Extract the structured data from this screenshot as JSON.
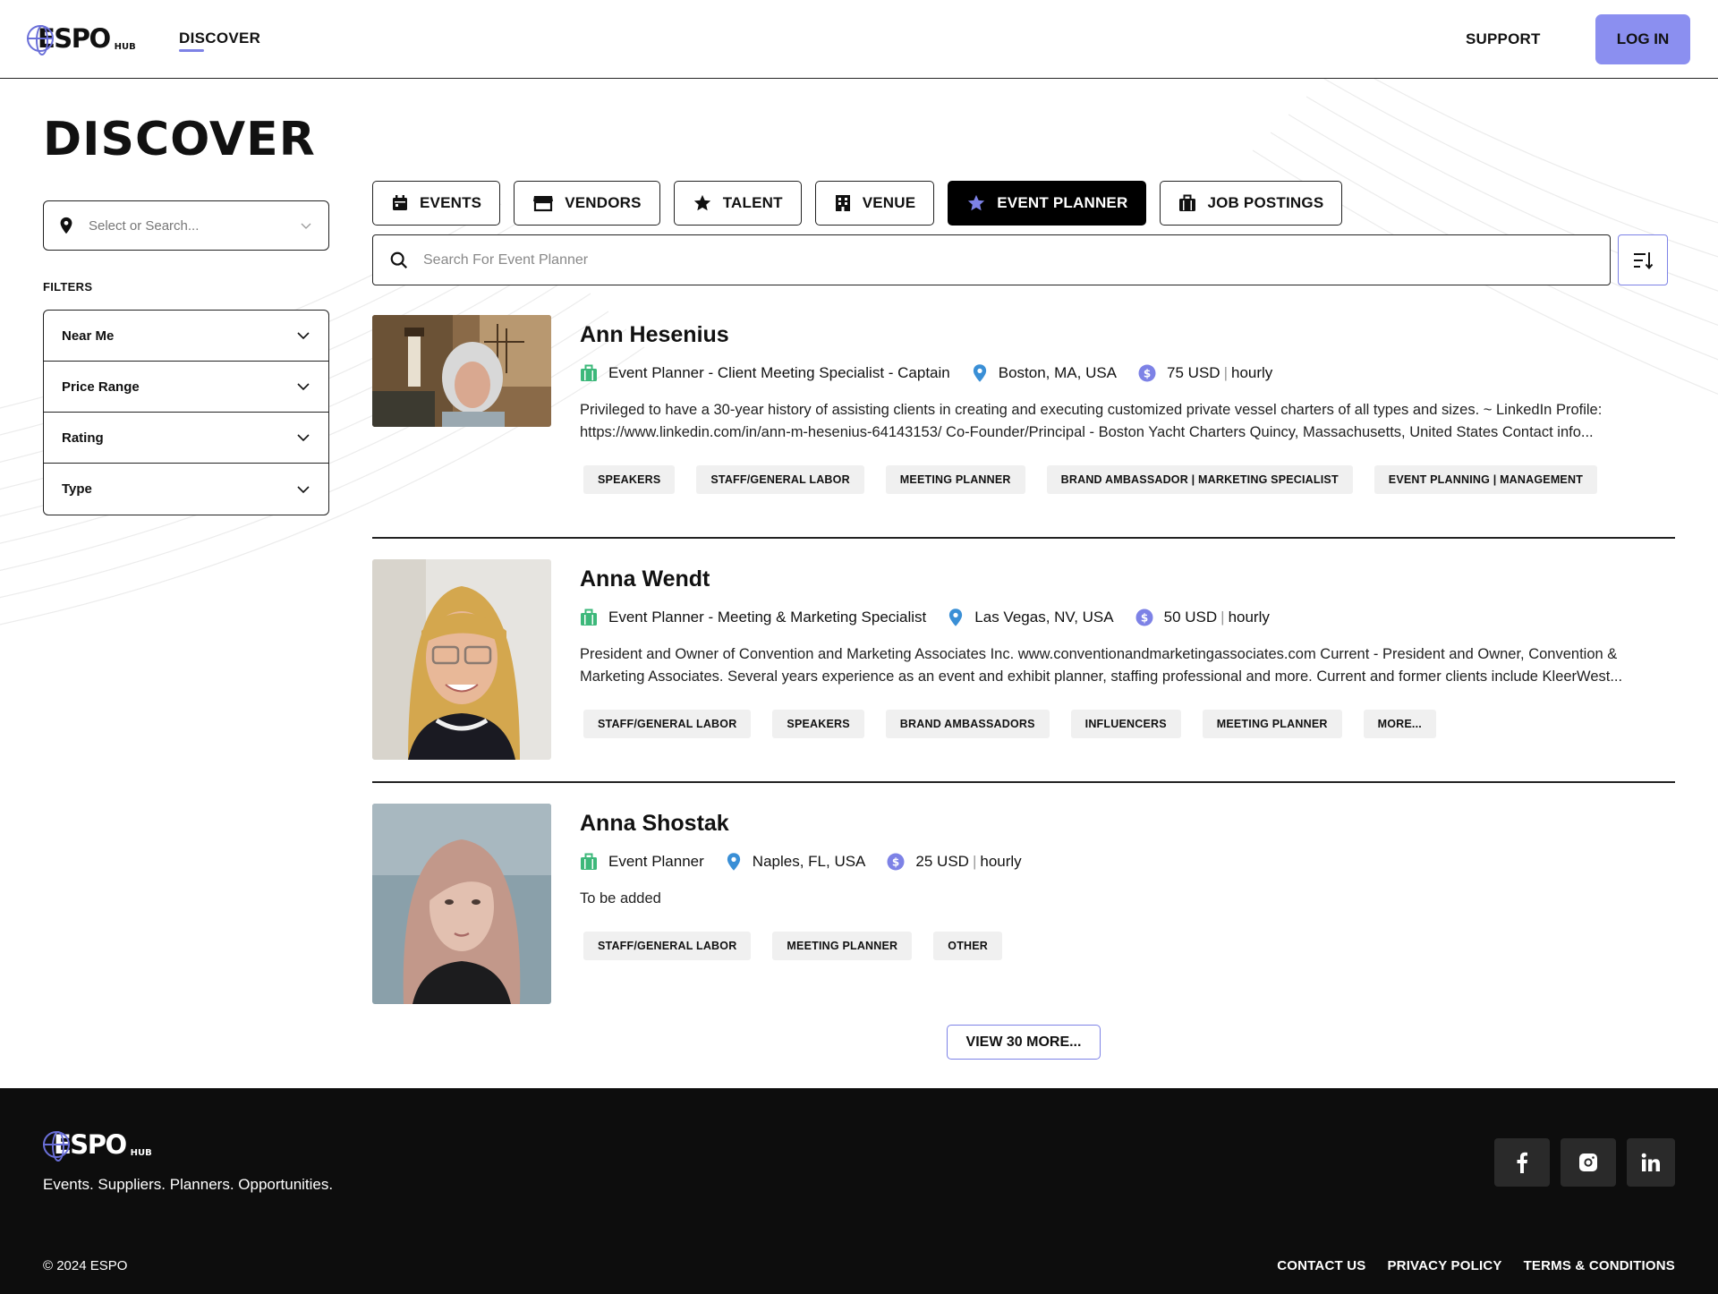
{
  "header": {
    "logo_text": "ESPO",
    "logo_sub": "HUB",
    "nav_discover": "DISCOVER",
    "nav_support": "SUPPORT",
    "login_label": "LOG IN"
  },
  "page_title": "DISCOVER",
  "location": {
    "placeholder": "Select or Search..."
  },
  "filters": {
    "label": "FILTERS",
    "items": [
      "Near Me",
      "Price Range",
      "Rating",
      "Type"
    ]
  },
  "tabs": [
    {
      "label": "EVENTS",
      "icon": "calendar-icon",
      "active": false
    },
    {
      "label": "VENDORS",
      "icon": "store-icon",
      "active": false
    },
    {
      "label": "TALENT",
      "icon": "star-icon",
      "active": false
    },
    {
      "label": "VENUE",
      "icon": "building-icon",
      "active": false
    },
    {
      "label": "EVENT PLANNER",
      "icon": "star-icon",
      "active": true
    },
    {
      "label": "JOB POSTINGS",
      "icon": "briefcase-icon",
      "active": false
    }
  ],
  "search": {
    "placeholder": "Search For Event Planner"
  },
  "listings": [
    {
      "name": "Ann Hesenius",
      "role": "Event Planner - Client Meeting Specialist - Captain",
      "location": "Boston, MA, USA",
      "rate": "75 USD",
      "rate_unit": "hourly",
      "description": "Privileged to have a 30-year history of assisting clients in creating and executing customized private vessel charters of all types and sizes. ~ LinkedIn Profile: https://www.linkedin.com/in/ann-m-hesenius-64143153/ Co-Founder/Principal - Boston Yacht Charters Quincy, Massachusetts, United States Contact info...",
      "tags": [
        "SPEAKERS",
        "STAFF/GENERAL LABOR",
        "MEETING PLANNER",
        "BRAND AMBASSADOR | MARKETING SPECIALIST",
        "EVENT PLANNING | MANAGEMENT"
      ]
    },
    {
      "name": "Anna Wendt",
      "role": "Event Planner - Meeting & Marketing Specialist",
      "location": "Las Vegas, NV, USA",
      "rate": "50 USD",
      "rate_unit": "hourly",
      "description": "President and Owner of Convention and Marketing Associates Inc. www.conventionandmarketingassociates.com Current - President and Owner, Convention & Marketing Associates. Several years experience as an event and exhibit planner, staffing professional and more. Current and former clients include KleerWest...",
      "tags": [
        "STAFF/GENERAL LABOR",
        "SPEAKERS",
        "BRAND AMBASSADORS",
        "INFLUENCERS",
        "MEETING PLANNER",
        "MORE..."
      ]
    },
    {
      "name": "Anna Shostak",
      "role": "Event Planner",
      "location": "Naples, FL, USA",
      "rate": "25 USD",
      "rate_unit": "hourly",
      "description": "To be added",
      "tags": [
        "STAFF/GENERAL LABOR",
        "MEETING PLANNER",
        "OTHER"
      ]
    }
  ],
  "view_more_label": "VIEW 30 MORE...",
  "footer": {
    "tagline": "Events. Suppliers. Planners. Opportunities.",
    "copyright": "© 2024 ESPO",
    "links": [
      "CONTACT US",
      "PRIVACY POLICY",
      "TERMS & CONDITIONS"
    ],
    "socials": [
      "facebook-icon",
      "instagram-icon",
      "linkedin-icon"
    ]
  },
  "colors": {
    "accent": "#8b8ff0",
    "role_icon": "#3cb87a",
    "location_icon": "#3a8fd6",
    "rate_icon": "#7d82e6"
  }
}
